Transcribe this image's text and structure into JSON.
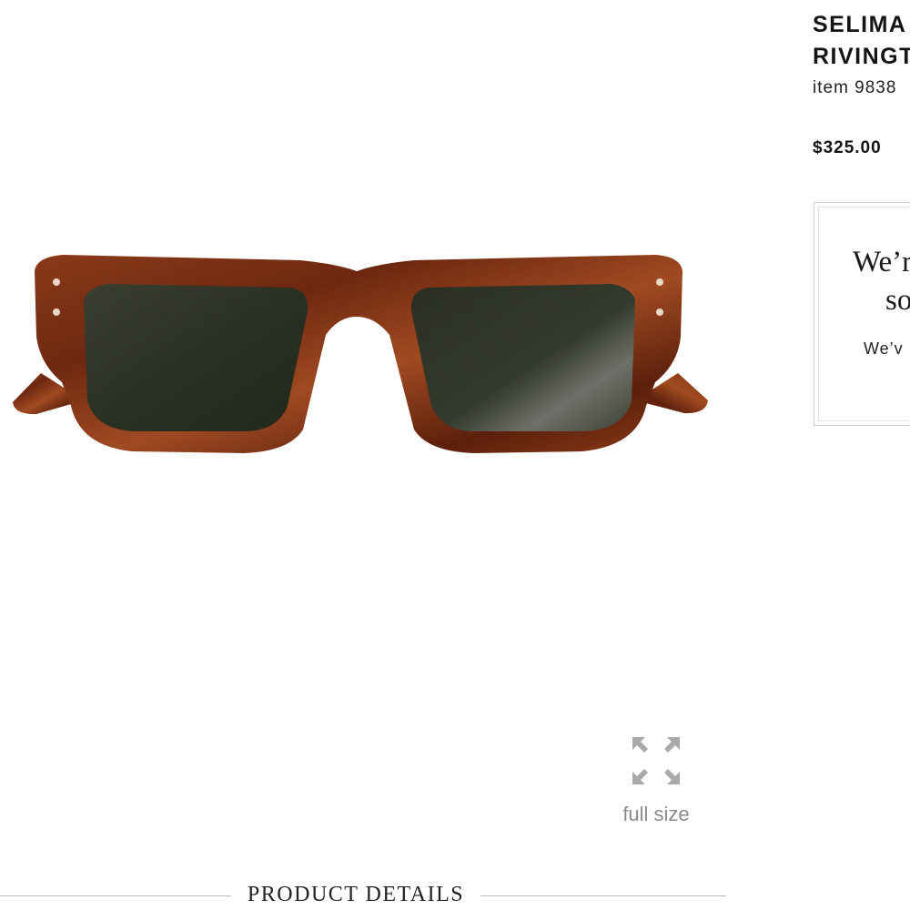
{
  "product": {
    "name_line1": "SELIMA",
    "name_line2": "RIVINGT",
    "item_number": "item 9838",
    "price": "$325.00"
  },
  "notice": {
    "heading_line1": "We’r",
    "heading_line2": "so",
    "body": "We’v"
  },
  "gallery": {
    "full_size_label": "full size",
    "expand_icon": "expand-arrows-icon"
  },
  "details": {
    "section_title": "PRODUCT DETAILS"
  },
  "colors": {
    "frame": "#7a2e14",
    "lens": "#2a2f22",
    "label_gray": "#8a8a8a"
  }
}
